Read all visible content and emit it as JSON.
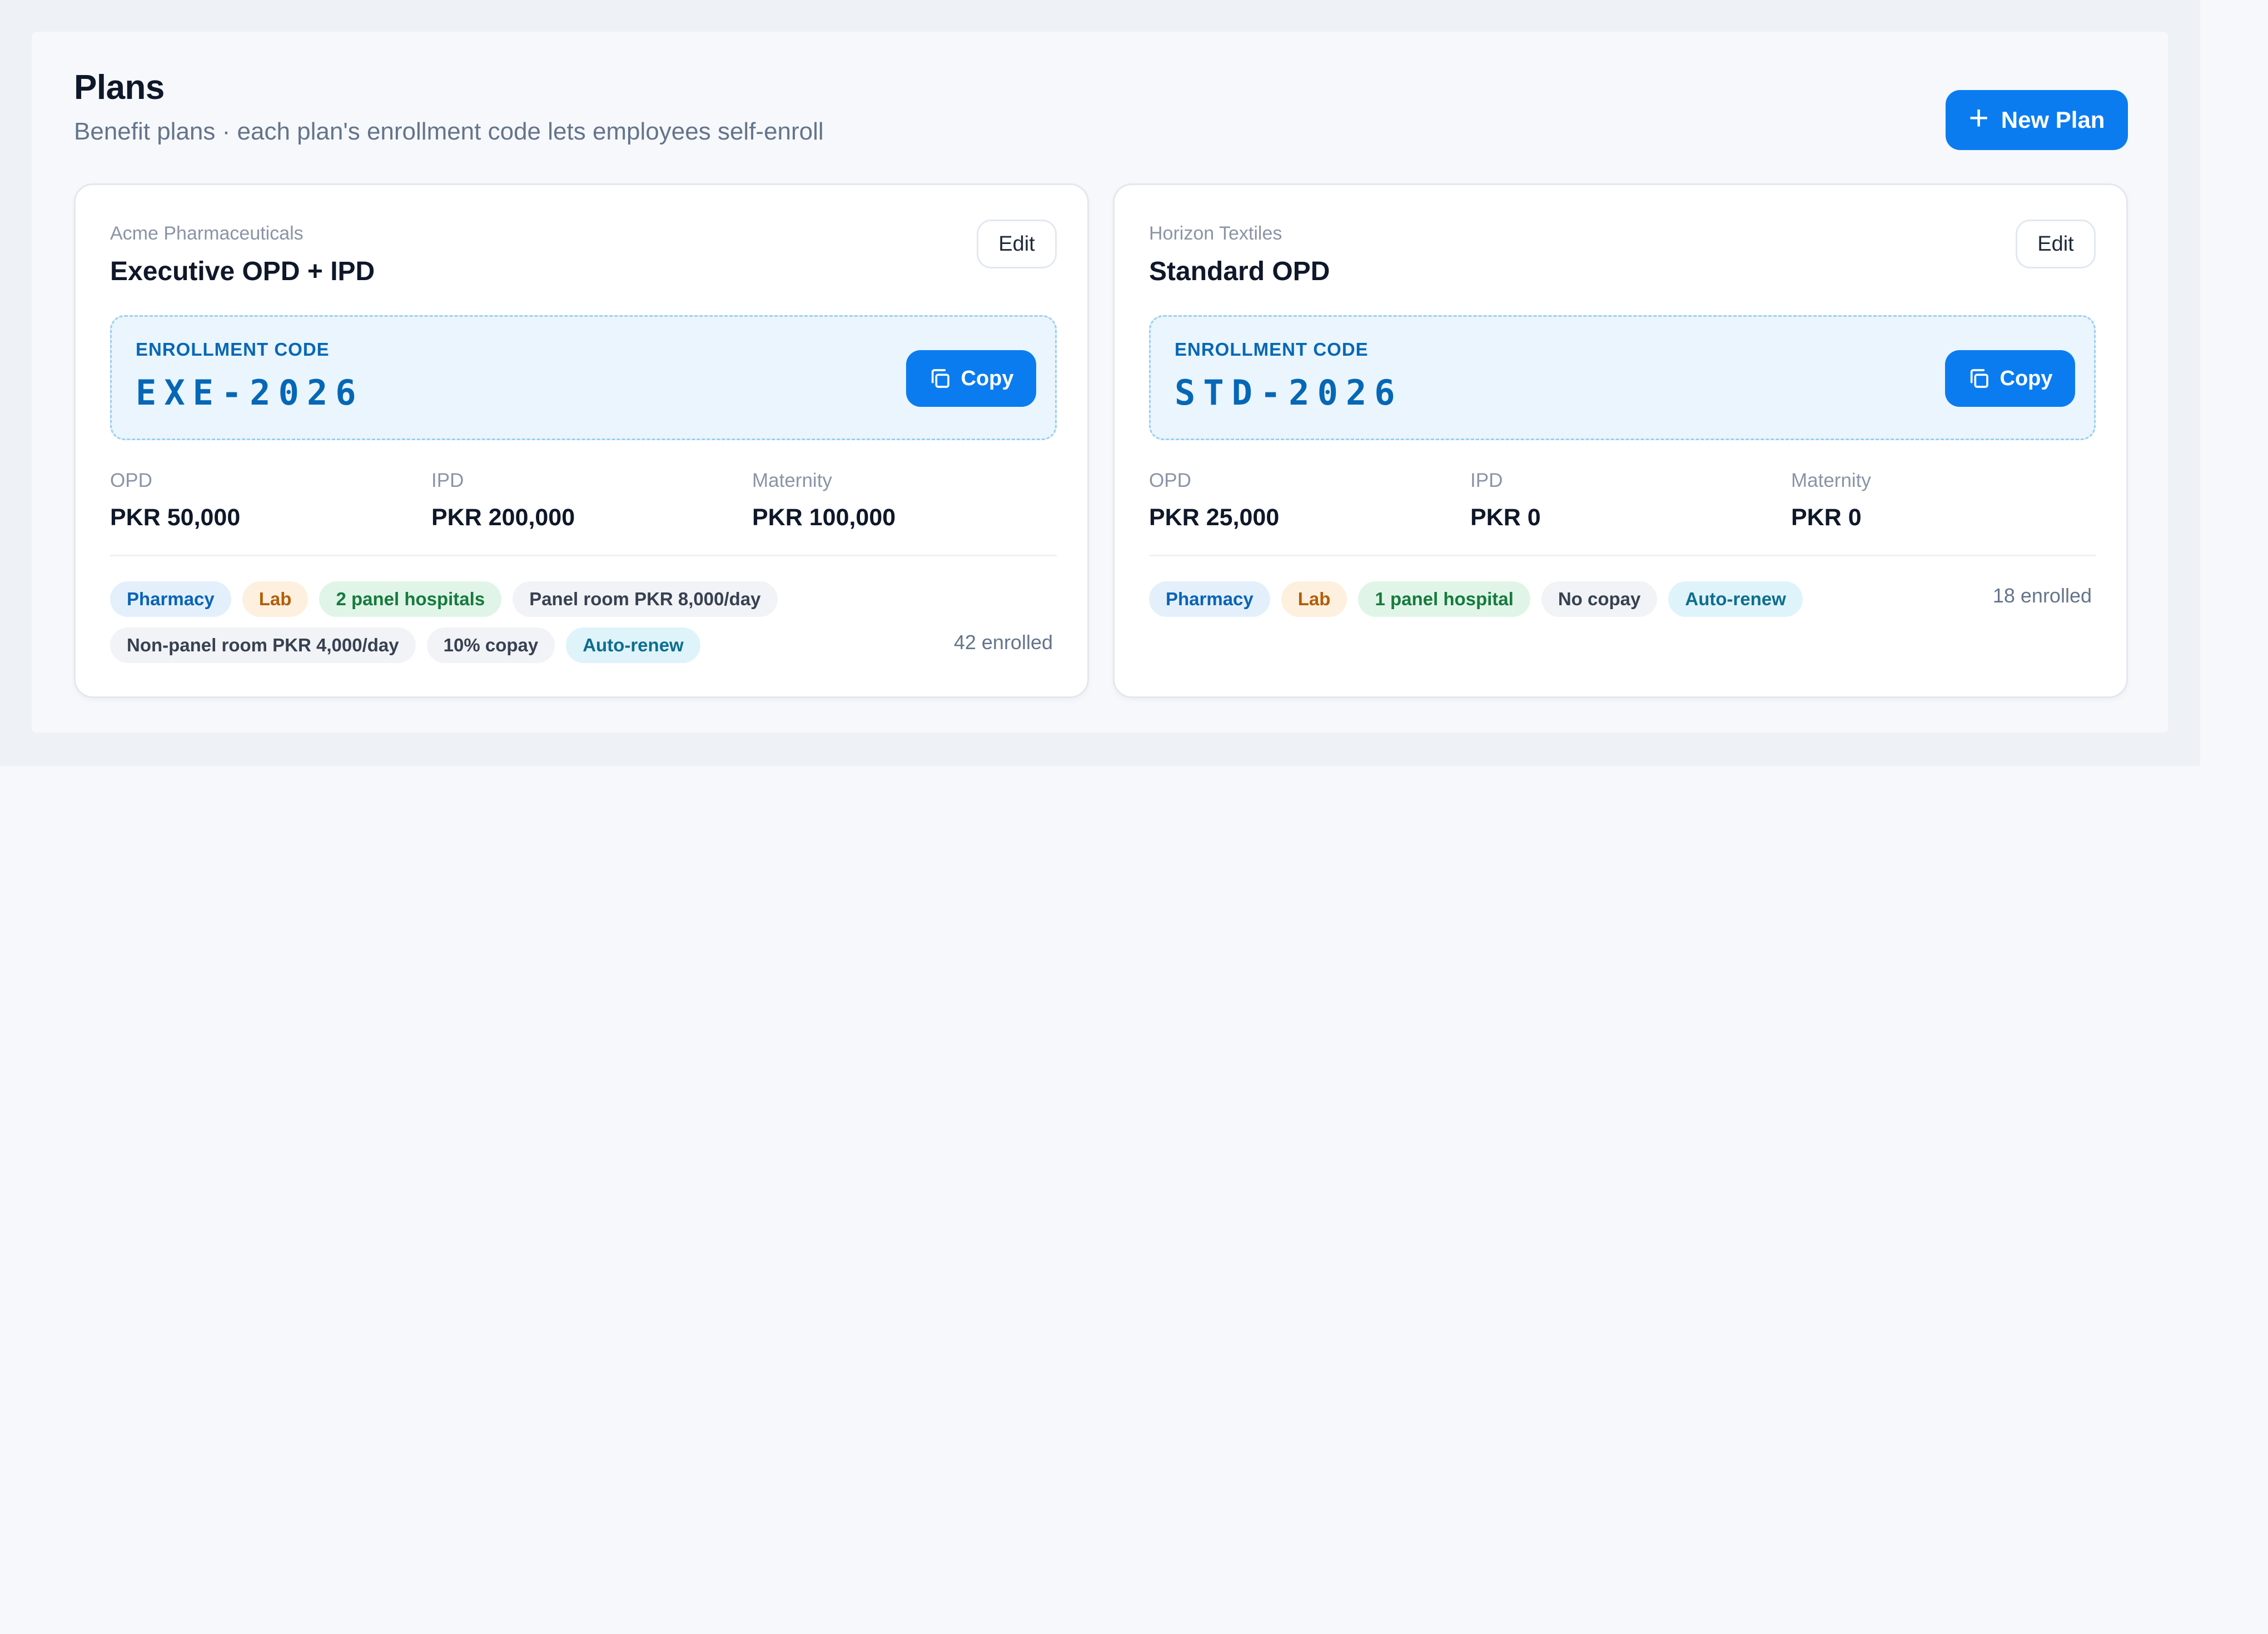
{
  "header": {
    "title": "Plans",
    "subtitle": "Benefit plans · each plan's enrollment code lets employees self-enroll",
    "new_plan_label": "New Plan"
  },
  "colors": {
    "accent": "#0b7cf0",
    "code_text": "#0567b5",
    "code_bg": "#eaf5fe"
  },
  "plans": [
    {
      "company": "Acme Pharmaceuticals",
      "name": "Executive OPD + IPD",
      "edit_label": "Edit",
      "enrollment_label": "ENROLLMENT CODE",
      "enrollment_code": "EXE-2026",
      "copy_label": "Copy",
      "limits": [
        {
          "label": "OPD",
          "value": "PKR 50,000"
        },
        {
          "label": "IPD",
          "value": "PKR 200,000"
        },
        {
          "label": "Maternity",
          "value": "PKR 100,000"
        }
      ],
      "tags": [
        {
          "text": "Pharmacy",
          "color": "blue"
        },
        {
          "text": "Lab",
          "color": "orange"
        },
        {
          "text": "2 panel hospitals",
          "color": "green"
        },
        {
          "text": "Panel room PKR 8,000/day",
          "color": "gray"
        },
        {
          "text": "Non-panel room PKR 4,000/day",
          "color": "gray"
        },
        {
          "text": "10% copay",
          "color": "gray"
        },
        {
          "text": "Auto-renew",
          "color": "cyan"
        }
      ],
      "enrolled": "42 enrolled"
    },
    {
      "company": "Horizon Textiles",
      "name": "Standard OPD",
      "edit_label": "Edit",
      "enrollment_label": "ENROLLMENT CODE",
      "enrollment_code": "STD-2026",
      "copy_label": "Copy",
      "limits": [
        {
          "label": "OPD",
          "value": "PKR 25,000"
        },
        {
          "label": "IPD",
          "value": "PKR 0"
        },
        {
          "label": "Maternity",
          "value": "PKR 0"
        }
      ],
      "tags": [
        {
          "text": "Pharmacy",
          "color": "blue"
        },
        {
          "text": "Lab",
          "color": "orange"
        },
        {
          "text": "1 panel hospital",
          "color": "green"
        },
        {
          "text": "No copay",
          "color": "gray"
        },
        {
          "text": "Auto-renew",
          "color": "cyan"
        }
      ],
      "enrolled": "18 enrolled"
    }
  ]
}
